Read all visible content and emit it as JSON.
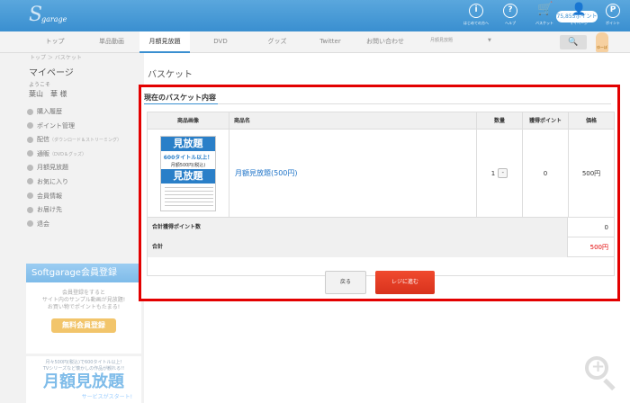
{
  "header": {
    "logo_s": "S",
    "logo_text": "garage",
    "icons": [
      {
        "icon": "info-icon",
        "glyph": "i",
        "label": "はじめての方へ"
      },
      {
        "icon": "help-icon",
        "glyph": "?",
        "label": "ヘルプ"
      },
      {
        "icon": "cart-icon",
        "glyph": "🛒",
        "label": "バスケット"
      },
      {
        "icon": "user-icon",
        "glyph": "👤",
        "label": "マイページ"
      },
      {
        "icon": "point-icon",
        "glyph": "P",
        "label": "ポイント"
      }
    ],
    "points": "75,855ポイント"
  },
  "nav": {
    "items": [
      "トップ",
      "単品動画",
      "月額見放題",
      "DVD",
      "グッズ",
      "Twitter",
      "お問い合わせ"
    ],
    "search_placeholder": "月額見放題",
    "search_dropdown": "▼",
    "search_button": "🔍",
    "char_label": "ゆーぼ"
  },
  "sidebar": {
    "breadcrumb": "トップ ＞ バスケット",
    "title": "マイページ",
    "welcome": "ようこそ",
    "username": "葉山　華 様",
    "menu": [
      {
        "label": "購入履歴",
        "sub": ""
      },
      {
        "label": "ポイント管理",
        "sub": ""
      },
      {
        "label": "配信",
        "sub": "（ダウンロード＆ストリーミング）"
      },
      {
        "label": "通販",
        "sub": "（DVD＆グッズ）"
      },
      {
        "label": "月額見放題",
        "sub": ""
      },
      {
        "label": "お気に入り",
        "sub": ""
      },
      {
        "label": "会員情報",
        "sub": ""
      },
      {
        "label": "お届け先",
        "sub": ""
      },
      {
        "label": "退会",
        "sub": ""
      }
    ],
    "reg": {
      "head": "Softgarage会員登録",
      "text1": "会員登録をすると",
      "text2": "サイト内のサンプル動画が見放題!",
      "text3": "お買い物でポイントもたまる!",
      "button": "無料会員登録"
    },
    "promo": {
      "line1": "月々500円(税込)で600タイトル以上!",
      "line2": "TVシリーズなど懐かしの作品が観れる!!",
      "big": "月額見放題",
      "sub": "サービスがスタート!"
    }
  },
  "main": {
    "page_title": "バスケット",
    "basket_heading": "現在のバスケット内容",
    "columns": [
      "商品画像",
      "商品名",
      "数量",
      "獲得ポイント",
      "価格"
    ],
    "item": {
      "thumb_top": "見放題",
      "thumb_l1": "600タイトル以上！",
      "thumb_l2": "月額500円(税込)",
      "thumb_big": "見放題",
      "name": "月額見放題(500円)",
      "qty": "1",
      "qty_minus": "-",
      "points": "0",
      "price": "500円"
    },
    "points_label": "合計獲得ポイント数",
    "points_total": "0",
    "total_label": "合計",
    "total_value": "500円",
    "back_button": "戻る",
    "checkout_button": "レジに進む"
  }
}
